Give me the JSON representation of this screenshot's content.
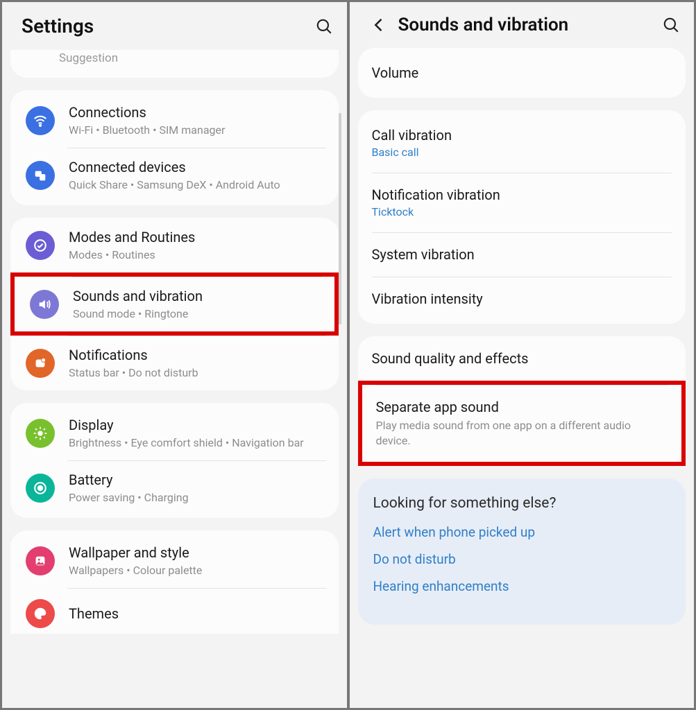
{
  "left": {
    "title": "Settings",
    "partial_top_text": "Suggestion",
    "groups": [
      [
        {
          "icon": "wifi-icon",
          "color": "ic-blue",
          "title": "Connections",
          "sub": "Wi-Fi  •  Bluetooth  •  SIM manager"
        },
        {
          "icon": "devices-icon",
          "color": "ic-blue",
          "title": "Connected devices",
          "sub": "Quick Share  •  Samsung DeX  •  Android Auto"
        }
      ],
      [
        {
          "icon": "check-icon",
          "color": "ic-violet",
          "title": "Modes and Routines",
          "sub": "Modes  •  Routines"
        },
        {
          "icon": "speaker-icon",
          "color": "ic-lvio",
          "title": "Sounds and vibration",
          "sub": "Sound mode  •  Ringtone",
          "highlight": true
        },
        {
          "icon": "notification-icon",
          "color": "ic-orange",
          "title": "Notifications",
          "sub": "Status bar  •  Do not disturb"
        }
      ],
      [
        {
          "icon": "brightness-icon",
          "color": "ic-green",
          "title": "Display",
          "sub": "Brightness  •  Eye comfort shield  •  Navigation bar"
        },
        {
          "icon": "battery-icon",
          "color": "ic-teal",
          "title": "Battery",
          "sub": "Power saving  •  Charging"
        }
      ],
      [
        {
          "icon": "wallpaper-icon",
          "color": "ic-pink",
          "title": "Wallpaper and style",
          "sub": "Wallpapers  •  Colour palette"
        },
        {
          "icon": "themes-icon",
          "color": "ic-red",
          "title": "Themes",
          "sub": ""
        }
      ]
    ]
  },
  "right": {
    "title": "Sounds and vibration",
    "groups": [
      [
        {
          "title": "Volume"
        }
      ],
      [
        {
          "title": "Call vibration",
          "sub": "Basic call"
        },
        {
          "title": "Notification vibration",
          "sub": "Ticktock"
        },
        {
          "title": "System vibration"
        },
        {
          "title": "Vibration intensity"
        }
      ],
      [
        {
          "title": "Sound quality and effects"
        },
        {
          "title": "Separate app sound",
          "desc": "Play media sound from one app on a different audio device.",
          "highlight": true
        }
      ]
    ],
    "lookup": {
      "title": "Looking for something else?",
      "links": [
        "Alert when phone picked up",
        "Do not disturb",
        "Hearing enhancements"
      ]
    }
  }
}
